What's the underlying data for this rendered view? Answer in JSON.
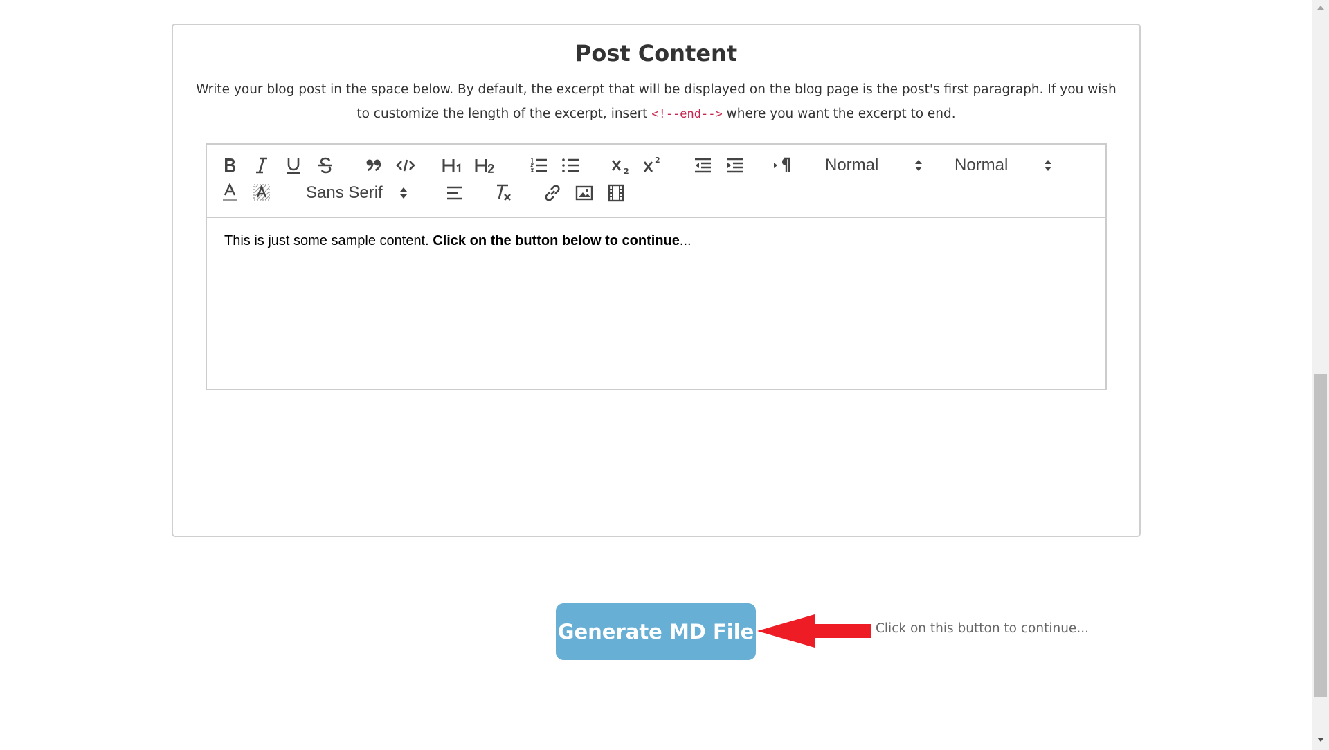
{
  "card": {
    "title": "Post Content",
    "desc_part1": "Write your blog post in the space below. By default, the excerpt that will be displayed on the blog page is the post's first paragraph. If you wish to customize the length of the excerpt, insert",
    "desc_code": "<!--end-->",
    "desc_part2": "where you want the excerpt to end."
  },
  "toolbar": {
    "header_picker": "Normal",
    "size_picker": "Normal",
    "font_picker": "Sans Serif"
  },
  "editor": {
    "content_plain": "This is just some sample content.",
    "content_bold": "Click on the button below to continue",
    "content_tail": "..."
  },
  "generate_button": {
    "label": "Generate MD File"
  },
  "hint": {
    "text": "Click on this button to continue..."
  },
  "colors": {
    "button_bg": "#67afd4",
    "arrow": "#ee1c25",
    "code_text": "#c7254e"
  },
  "icons": [
    "bold-icon",
    "italic-icon",
    "underline-icon",
    "strikethrough-icon",
    "blockquote-icon",
    "code-block-icon",
    "header-1-icon",
    "header-2-icon",
    "ordered-list-icon",
    "bullet-list-icon",
    "subscript-icon",
    "superscript-icon",
    "outdent-icon",
    "indent-icon",
    "rtl-direction-icon",
    "text-color-icon",
    "background-color-icon",
    "align-icon",
    "clear-format-icon",
    "link-icon",
    "image-icon",
    "video-icon"
  ]
}
